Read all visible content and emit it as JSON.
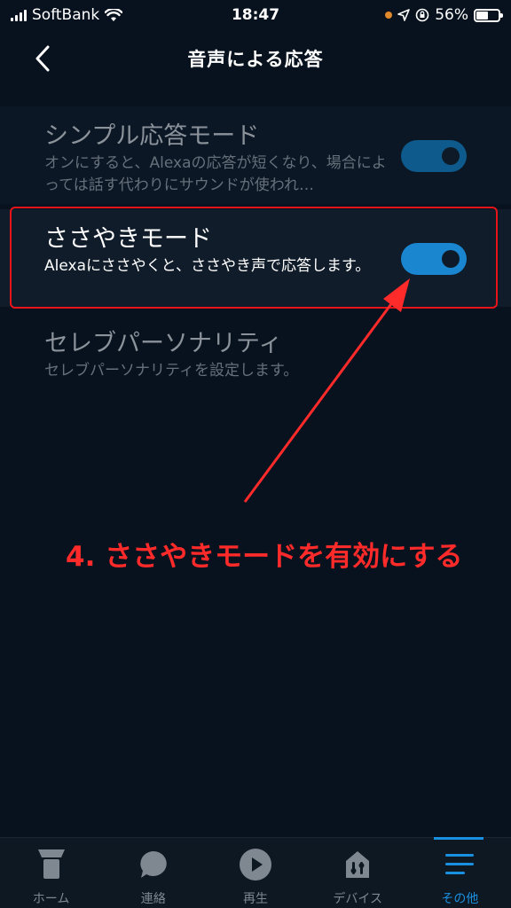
{
  "status_bar": {
    "carrier": "SoftBank",
    "time": "18:47",
    "battery": "56%",
    "battery_level": 0.56
  },
  "header": {
    "title": "音声による応答"
  },
  "settings": [
    {
      "title": "シンプル応答モード",
      "description": "オンにすると、Alexaの応答が短くなり、場合によっては話す代わりにサウンドが使われ…",
      "enabled": true
    },
    {
      "title": "ささやきモード",
      "description": "Alexaにささやくと、ささやき声で応答します。",
      "enabled": true
    },
    {
      "title": "セレブパーソナリティ",
      "description": "セレブパーソナリティを設定します。"
    }
  ],
  "annotation": {
    "text": "4. ささやきモードを有効にする",
    "color": "#ff2a2a"
  },
  "bottom_nav": {
    "items": [
      {
        "label": "ホーム",
        "icon": "home-icon"
      },
      {
        "label": "連絡",
        "icon": "chat-bubble-icon"
      },
      {
        "label": "再生",
        "icon": "play-icon"
      },
      {
        "label": "デバイス",
        "icon": "devices-icon"
      },
      {
        "label": "その他",
        "icon": "menu-icon",
        "active": true
      }
    ]
  },
  "colors": {
    "background": "#07121e",
    "toggle_on": "#1a86d0",
    "accent": "#1a90e0",
    "highlight": "#e8141a"
  }
}
